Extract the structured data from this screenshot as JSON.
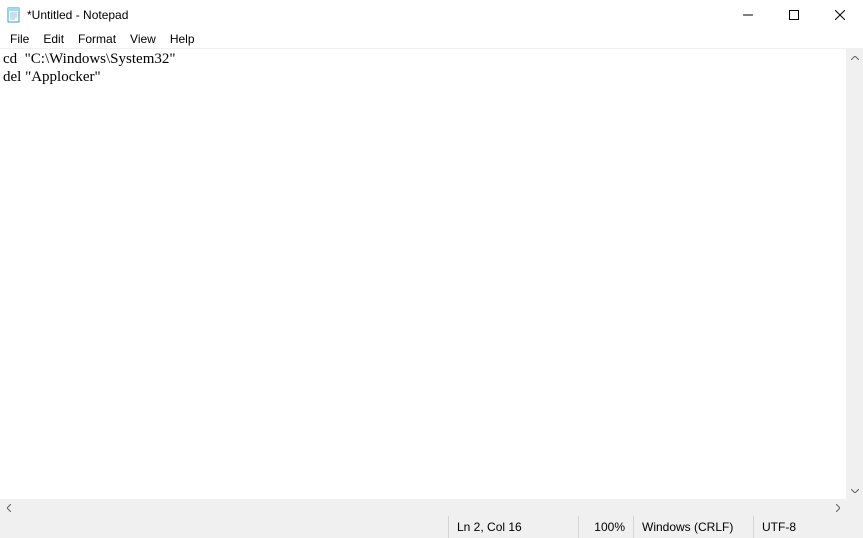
{
  "window": {
    "title": "*Untitled - Notepad"
  },
  "menu": {
    "file": "File",
    "edit": "Edit",
    "format": "Format",
    "view": "View",
    "help": "Help"
  },
  "document": {
    "content": "cd  \"C:\\Windows\\System32\"\ndel \"Applocker\""
  },
  "status": {
    "position": "Ln 2, Col 16",
    "zoom": "100%",
    "line_ending": "Windows (CRLF)",
    "encoding": "UTF-8"
  }
}
